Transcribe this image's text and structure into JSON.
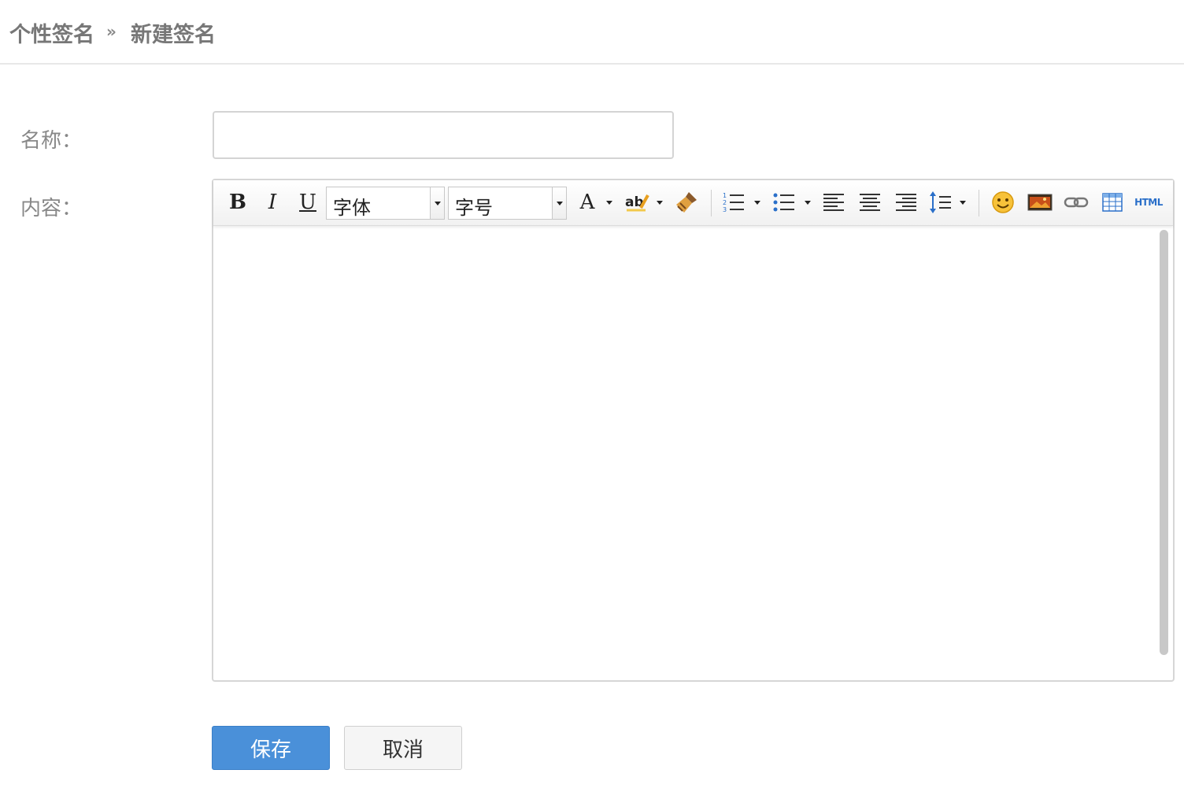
{
  "breadcrumb": {
    "parent": "个性签名",
    "separator": "»",
    "current": "新建签名"
  },
  "form": {
    "name_label": "名称：",
    "name_value": "",
    "content_label": "内容："
  },
  "editor": {
    "toolbar": {
      "bold": "B",
      "italic": "I",
      "underline": "U",
      "font_family": "字体",
      "font_size": "字号",
      "font_color": "A",
      "html": "HTML"
    },
    "content": ""
  },
  "buttons": {
    "save": "保存",
    "cancel": "取消"
  },
  "colors": {
    "primary": "#4a90d9",
    "label": "#888888",
    "breadcrumb": "#777777"
  }
}
